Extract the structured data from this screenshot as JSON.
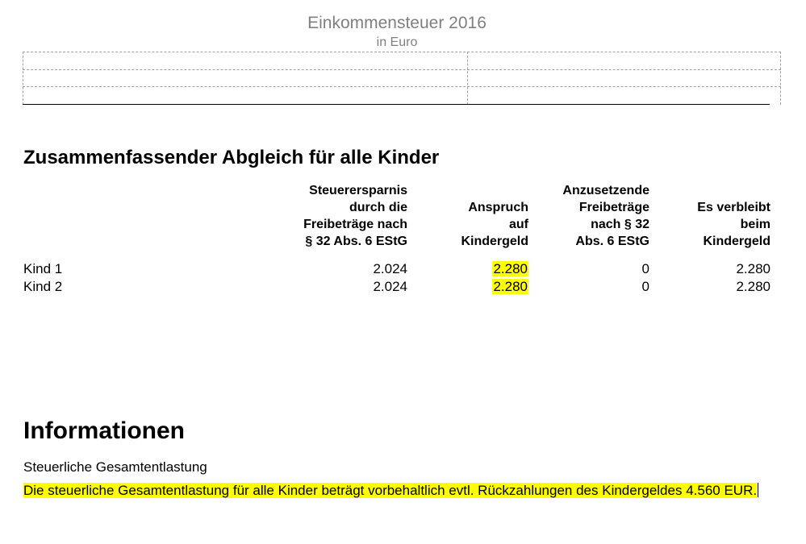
{
  "header": {
    "title": "Einkommensteuer 2016",
    "subtitle": "in Euro"
  },
  "summary": {
    "heading": "Zusammenfassender Abgleich für alle Kinder",
    "columns": [
      "Steuerersparnis\ndurch die\nFreibeträge nach\n§ 32 Abs. 6 EStG",
      "Anspruch\nauf\nKindergeld",
      "Anzusetzende\nFreibeträge\nnach § 32\nAbs. 6 EStG",
      "Es verbleibt\nbeim\nKindergeld"
    ],
    "rows": [
      {
        "label": "Kind 1",
        "values": [
          "2.024",
          "2.280",
          "0",
          "2.280"
        ]
      },
      {
        "label": "Kind 2",
        "values": [
          "2.024",
          "2.280",
          "0",
          "2.280"
        ]
      }
    ],
    "highlight_color": "#ffff00"
  },
  "info": {
    "heading": "Informationen",
    "label": "Steuerliche Gesamtentlastung",
    "text": "Die steuerliche Gesamtentlastung für alle Kinder beträgt vorbehaltlich evtl. Rückzahlungen des Kindergeldes 4.560 EUR."
  }
}
